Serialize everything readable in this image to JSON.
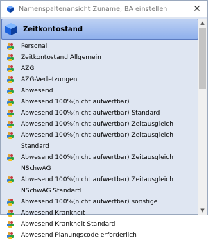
{
  "window": {
    "title": "Namenspaltenansicht Zuname, BA einstellen",
    "close_symbol": "✕"
  },
  "header": {
    "label": "Zeitkontostand"
  },
  "items": [
    {
      "label": "Personal"
    },
    {
      "label": "Zeitkontostand Allgemein"
    },
    {
      "label": "AZG"
    },
    {
      "label": "AZG-Verletzungen"
    },
    {
      "label": "Abwesend"
    },
    {
      "label": "Abwesend 100%(nicht aufwertbar)"
    },
    {
      "label": "Abwesend 100%(nicht aufwertbar)  Standard"
    },
    {
      "label": "Abwesend 100%(nicht aufwertbar) Zeitausgleich"
    },
    {
      "label": "Abwesend 100%(nicht aufwertbar) Zeitausgleich  Standard"
    },
    {
      "label": "Abwesend 100%(nicht aufwertbar) Zeitausgleich NSchwAG"
    },
    {
      "label": "Abwesend 100%(nicht aufwertbar) Zeitausgleich NSchwAG Standard"
    },
    {
      "label": "Abwesend 100%(nicht aufwertbar) sonstige"
    },
    {
      "label": "Abwesend Krankheit"
    },
    {
      "label": "Abwesend Krankheit  Standard"
    },
    {
      "label": "Abwesend Planungscode erforderlich"
    }
  ],
  "colors": {
    "header_top": "#bcd0f3",
    "header_bottom": "#8fb0ec",
    "panel_bg": "#dfe6f2"
  },
  "icons": {
    "title": "cube-icon",
    "header": "cube-icon",
    "item": "people-group-icon"
  }
}
